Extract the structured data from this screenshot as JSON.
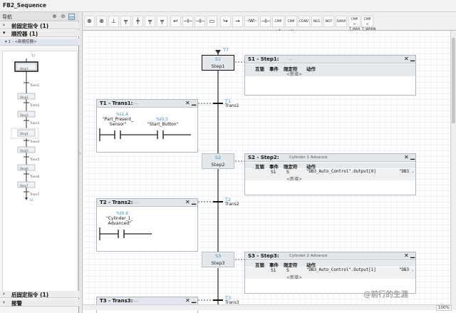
{
  "tab": {
    "title": "FB2_Sequence"
  },
  "left": {
    "header": "导航",
    "pre": {
      "arrow": "›",
      "label": "前固定指令 (1)"
    },
    "seq": {
      "arrow": "▾",
      "label": "顺控器 (1)"
    },
    "seq_item": "▾ 1 - <新顺控器>",
    "post": {
      "arrow": "›",
      "label": "后固定指令 (1)"
    },
    "alarm": {
      "arrow": "›",
      "label": "报警"
    },
    "overview": {
      "init": "T7",
      "steps": [
        "Step1",
        "Step2",
        "Step3",
        "Step4",
        "Step5",
        "Step6",
        "Step7"
      ],
      "trans": [
        "Trans1",
        "Trans2",
        "Trans3",
        "Trans4",
        "Trans5",
        "Trans6",
        "Trans7"
      ],
      "bottom": "S1"
    }
  },
  "toolbar": {
    "buttons": [
      "⊕",
      "⊕",
      "⊥",
      "╤",
      "╪",
      "╤",
      "╤",
      "↩",
      "⊣⊢",
      "⊣⊢",
      "▭",
      "↪",
      "→",
      "⊣W⊢",
      "⊣⊢"
    ],
    "text_buttons": [
      "CMP >T",
      "CMP >U",
      "CONV",
      "NEG",
      "NOT",
      "SWAP",
      "CMP > T_MAX",
      "CMP < T_WARN"
    ]
  },
  "sfc": {
    "top_label": "T7",
    "s1": {
      "num": "S1",
      "name": "Step1"
    },
    "t1": {
      "num": "T1",
      "name": "Trans1"
    },
    "s2": {
      "num": "S2",
      "name": "Step2"
    },
    "t2": {
      "num": "T2",
      "name": "Trans2"
    },
    "s3": {
      "num": "S3",
      "name": "Step3"
    },
    "t3": {
      "num": "T3",
      "name": "Trans3"
    }
  },
  "step_panels": {
    "headers": [
      "互锁",
      "事件",
      "限定符",
      "动作"
    ],
    "new_item": "<新增>",
    "s1": {
      "title": "S1 - Step1:",
      "comment": "...."
    },
    "s2": {
      "title": "S2 - Step2:",
      "comment": "Cylinder 1 Advance",
      "row": {
        "event": "S1",
        "qual": "S",
        "action": "\"DB3_Auto_Control\".Output[0]",
        "value": "\"DB3 ."
      }
    },
    "s3": {
      "title": "S3 - Step3:",
      "comment": "Cylinder 2 Advance",
      "row": {
        "event": "S1",
        "qual": "S",
        "action": "\"DB3_Auto_Control\".Output[1]",
        "value": "\"DB3 ."
      }
    }
  },
  "trans_panels": {
    "t1": {
      "title": "T1 - Trans1:",
      "comment": "....",
      "c1": {
        "addr": "%I1.4",
        "name": "\"Part_Present_\nSensor\""
      },
      "c2": {
        "addr": "%I0.5",
        "name": "\"Start_Button\""
      }
    },
    "t2": {
      "title": "T2 - Trans2:",
      "comment": "....",
      "c1": {
        "addr": "%I0.6",
        "name": "\"Cylinder_1_\nAdvanced\""
      }
    },
    "t3": {
      "title": "T3 - Trans3:",
      "comment": "...."
    }
  },
  "close": "✕",
  "min": "▁",
  "zoom": "100%",
  "watermark": "@前行的生涯"
}
